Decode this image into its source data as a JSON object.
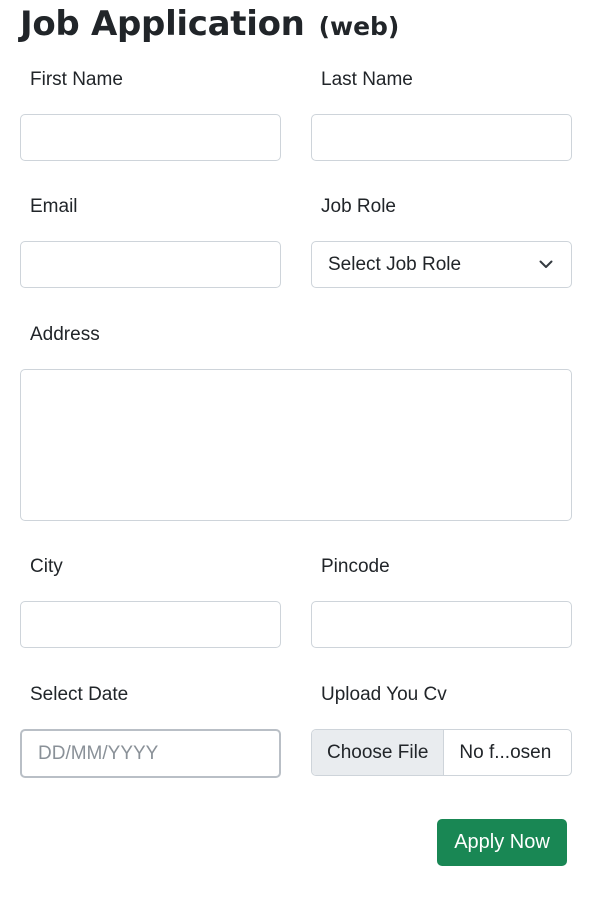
{
  "header": {
    "title": "Job Application",
    "subtitle": "(web)"
  },
  "form": {
    "first_name": {
      "label": "First Name",
      "value": "",
      "placeholder": ""
    },
    "last_name": {
      "label": "Last Name",
      "value": "",
      "placeholder": ""
    },
    "email": {
      "label": "Email",
      "value": "",
      "placeholder": ""
    },
    "job_role": {
      "label": "Job Role",
      "selected": "Select Job Role",
      "icon": "chevron-down-icon"
    },
    "address": {
      "label": "Address",
      "value": ""
    },
    "city": {
      "label": "City",
      "value": "",
      "placeholder": ""
    },
    "pincode": {
      "label": "Pincode",
      "value": "",
      "placeholder": ""
    },
    "date": {
      "label": "Select Date",
      "value": "",
      "placeholder": "DD/MM/YYYY"
    },
    "cv": {
      "label": "Upload You Cv",
      "button_label": "Choose File",
      "status": "No f...osen"
    },
    "submit_label": "Apply Now"
  },
  "colors": {
    "submit_bg": "#198754",
    "border": "#ced4da",
    "file_button_bg": "#e9ecef"
  }
}
